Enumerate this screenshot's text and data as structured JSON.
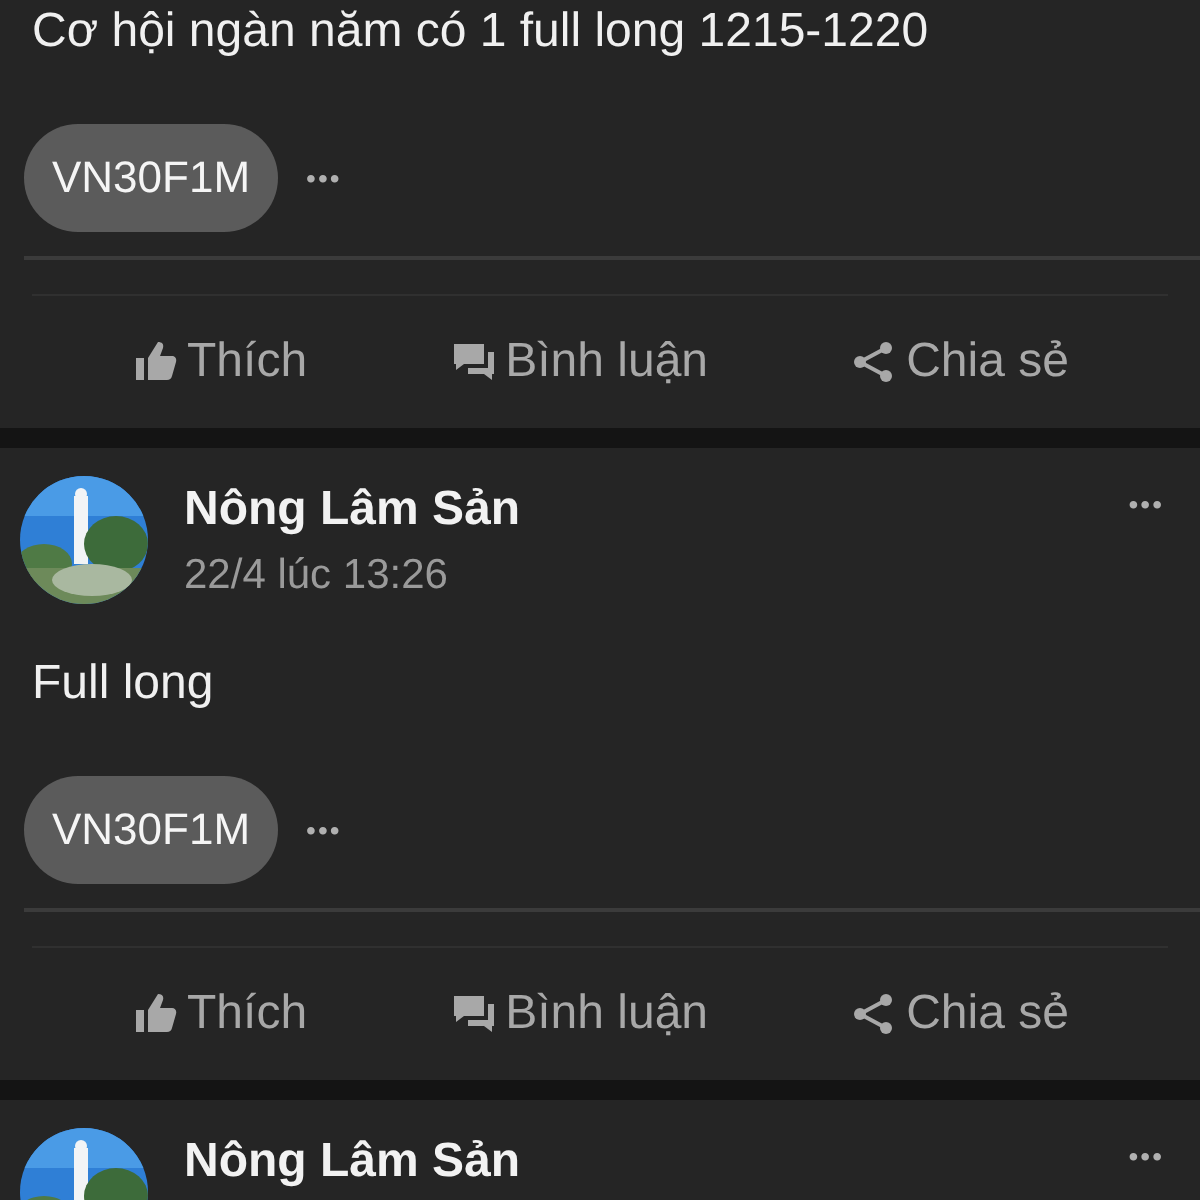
{
  "posts": [
    {
      "text": "Cơ hội ngàn năm có 1 full long 1215-1220",
      "tag": "VN30F1M",
      "more": "•••",
      "actions": [
        "Thích",
        "Bình luận",
        "Chia sẻ"
      ]
    },
    {
      "author": "Nông Lâm Sản",
      "time": "22/4 lúc 13:26",
      "menu": "•••",
      "text": "Full long",
      "tag": "VN30F1M",
      "more": "•••",
      "actions": [
        "Thích",
        "Bình luận",
        "Chia sẻ"
      ]
    },
    {
      "author": "Nông Lâm Sản",
      "menu": "•••"
    }
  ]
}
